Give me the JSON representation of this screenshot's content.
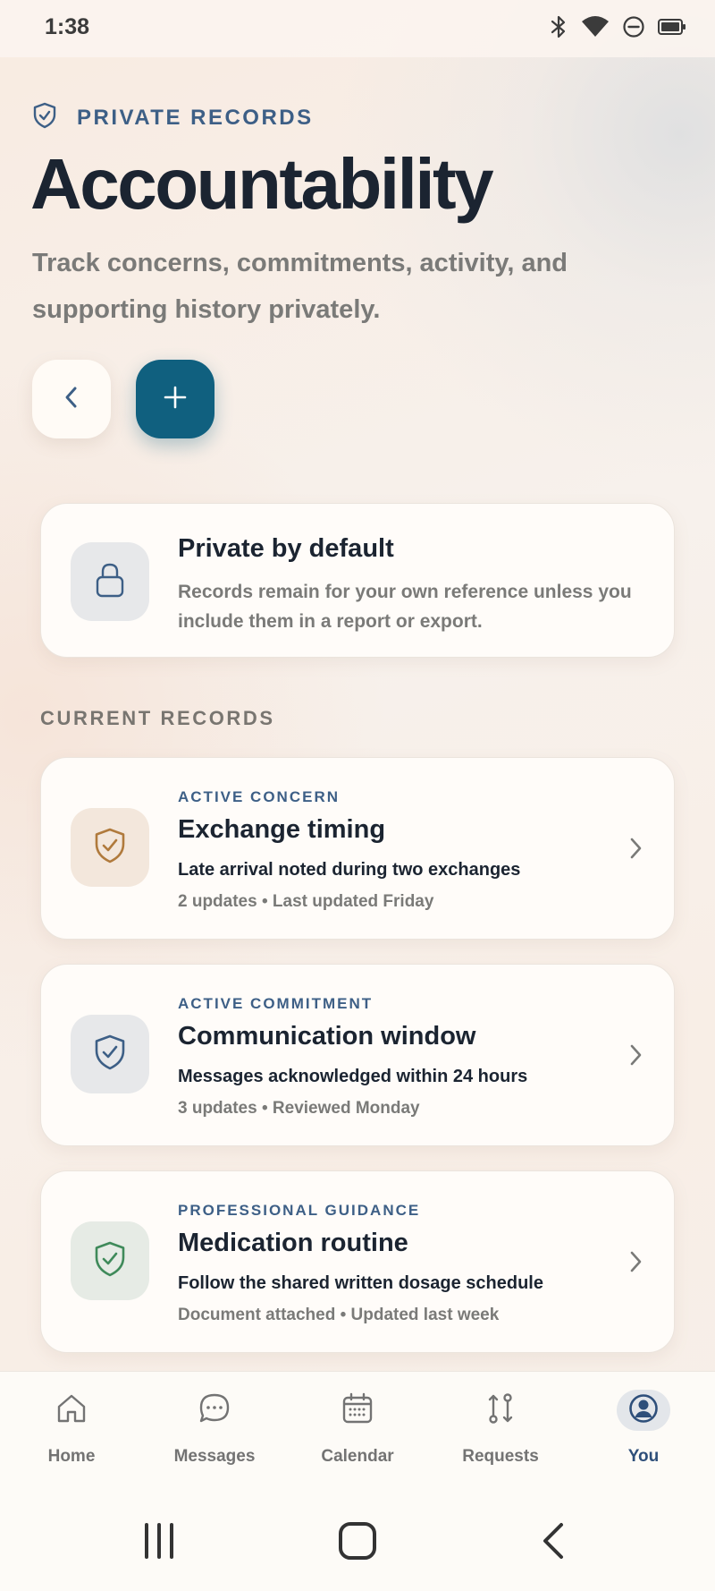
{
  "status_bar": {
    "time": "1:38",
    "icons": [
      "bluetooth-icon",
      "wifi-icon",
      "do-not-disturb-icon",
      "battery-icon"
    ]
  },
  "header": {
    "kicker": "PRIVATE RECORDS",
    "kicker_icon": "shield-icon",
    "title": "Accountability",
    "subtitle": "Track concerns, commitments, activity, and supporting history privately."
  },
  "actions": {
    "back_icon": "chevron-left-icon",
    "add_icon": "plus-icon"
  },
  "privacy_card": {
    "icon": "lock-icon",
    "title": "Private by default",
    "text": "Records remain for your own reference unless you include them in a report or export."
  },
  "records_section": {
    "label": "CURRENT RECORDS",
    "items": [
      {
        "kicker": "ACTIVE CONCERN",
        "title": "Exchange timing",
        "description": "Late arrival noted during two exchanges",
        "meta": "2 updates • Last updated Friday",
        "icon": "shield-check-icon",
        "icon_color": "#b07a3c",
        "icon_bg": "#f3e7dc"
      },
      {
        "kicker": "ACTIVE COMMITMENT",
        "title": "Communication window",
        "description": "Messages acknowledged within 24 hours",
        "meta": "3 updates • Reviewed Monday",
        "icon": "shield-check-icon",
        "icon_color": "#3d5f86",
        "icon_bg": "#e7e8ea"
      },
      {
        "kicker": "PROFESSIONAL GUIDANCE",
        "title": "Medication routine",
        "description": "Follow the shared written dosage schedule",
        "meta": "Document attached • Updated last week",
        "icon": "shield-check-icon",
        "icon_color": "#3f8a5a",
        "icon_bg": "#e6ebe5"
      }
    ]
  },
  "tab_bar": {
    "tabs": [
      {
        "label": "Home",
        "icon": "home-icon",
        "active": false
      },
      {
        "label": "Messages",
        "icon": "chat-bubble-icon",
        "active": false
      },
      {
        "label": "Calendar",
        "icon": "calendar-icon",
        "active": false
      },
      {
        "label": "Requests",
        "icon": "git-compare-icon",
        "active": false
      },
      {
        "label": "You",
        "icon": "user-circle-icon",
        "active": true
      }
    ]
  },
  "nav_bar": {
    "buttons": [
      "recents-icon",
      "home-button-icon",
      "back-icon"
    ]
  },
  "colors": {
    "accent": "#10607f",
    "label_blue": "#3d5f86",
    "title_dark": "#1b2431",
    "muted": "#7a7a78"
  }
}
